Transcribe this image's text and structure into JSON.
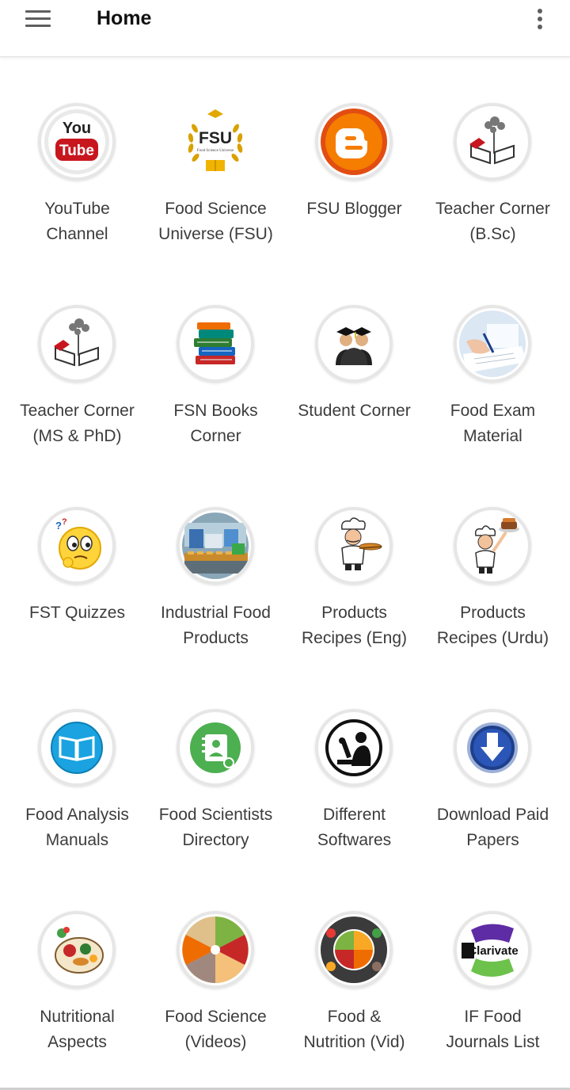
{
  "appbar": {
    "title": "Home",
    "menu_icon": "hamburger-menu-icon",
    "more_icon": "more-vert-icon"
  },
  "tiles": [
    {
      "label": "YouTube\nChannel",
      "icon": "youtube-icon",
      "logo_text_top": "You",
      "logo_text_bottom": "Tube"
    },
    {
      "label": "Food Science\nUniverse (FSU)",
      "icon": "fsu-laurel-logo-icon",
      "logo_text_top": "FSU",
      "logo_text_bottom": "Food Science Universe"
    },
    {
      "label": "FSU Blogger",
      "icon": "blogger-icon"
    },
    {
      "label": "Teacher Corner\n(B.Sc)",
      "icon": "book-tree-icon"
    },
    {
      "label": "Teacher Corner\n(MS & PhD)",
      "icon": "book-tree-icon"
    },
    {
      "label": "FSN Books\nCorner",
      "icon": "books-stack-icon"
    },
    {
      "label": "Student Corner",
      "icon": "graduates-icon"
    },
    {
      "label": "Food Exam\nMaterial",
      "icon": "writing-hand-icon"
    },
    {
      "label": "FST Quizzes",
      "icon": "thinking-face-icon"
    },
    {
      "label": "Industrial Food\nProducts",
      "icon": "factory-line-icon"
    },
    {
      "label": "Products\nRecipes (Eng)",
      "icon": "chef-pizza-icon"
    },
    {
      "label": "Products\nRecipes (Urdu)",
      "icon": "chef-cake-icon"
    },
    {
      "label": "Food Analysis\nManuals",
      "icon": "manual-book-icon"
    },
    {
      "label": "Food Scientists\nDirectory",
      "icon": "contacts-directory-icon"
    },
    {
      "label": "Different\nSoftwares",
      "icon": "microscope-scientist-icon"
    },
    {
      "label": "Download Paid\nPapers",
      "icon": "download-arrow-icon"
    },
    {
      "label": "Nutritional\nAspects",
      "icon": "food-platter-icon"
    },
    {
      "label": "Food Science\n(Videos)",
      "icon": "food-collage-icon"
    },
    {
      "label": "Food &\nNutrition (Vid)",
      "icon": "healthy-plate-icon"
    },
    {
      "label": "IF Food\nJournals List",
      "icon": "clarivate-logo-icon",
      "logo_text_top": "Clarivate"
    }
  ]
}
